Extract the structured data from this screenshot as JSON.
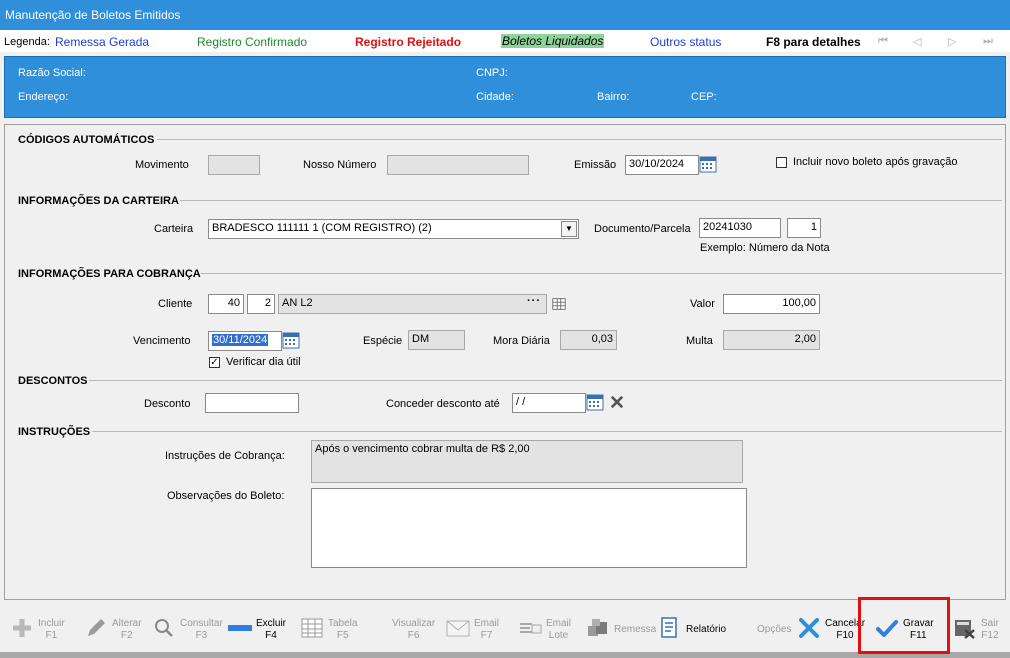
{
  "window": {
    "title": "Manutenção de Boletos Emitidos"
  },
  "legend": {
    "label": "Legenda:",
    "items": [
      {
        "text": "Remessa Gerada",
        "color": "#1a3fd6"
      },
      {
        "text": "Registro Confirmado",
        "color": "#1a8a2a"
      },
      {
        "text": "Registro Rejeitado",
        "color": "#e01010"
      },
      {
        "text": "Boletos Liquidados",
        "color": "#000000",
        "bg": "#8ed39a"
      },
      {
        "text": "Outros status",
        "color": "#1a3fd6"
      }
    ],
    "hint": "F8 para detalhes",
    "nav_icons": [
      "first-icon",
      "prev-icon",
      "next-icon",
      "last-icon"
    ]
  },
  "info": {
    "razao_social": "Razão Social:",
    "cnpj": "CNPJ:",
    "endereco": "Endereço:",
    "cidade": "Cidade:",
    "bairro": "Bairro:",
    "cep": "CEP:"
  },
  "codigos": {
    "section": "CÓDIGOS AUTOMÁTICOS",
    "movimento_label": "Movimento",
    "movimento_value": "",
    "nosso_numero_label": "Nosso Número",
    "nosso_numero_value": "",
    "emissao_label": "Emissão",
    "emissao_value": "30/10/2024",
    "incluir_novo_label": "Incluir novo boleto após gravação",
    "incluir_novo_checked": false
  },
  "carteira": {
    "section": "INFORMAÇÕES DA CARTEIRA",
    "carteira_label": "Carteira",
    "carteira_value": "BRADESCO  111111 1 (COM REGISTRO)  (2)",
    "documento_label": "Documento/Parcela",
    "documento_value": "20241030",
    "parcela_value": "1",
    "exemplo": "Exemplo: Número da Nota"
  },
  "cobranca": {
    "section": "INFORMAÇÕES PARA COBRANÇA",
    "cliente_label": "Cliente",
    "cliente_codigo": "40",
    "cliente_sub": "2",
    "cliente_nome": "AN L2",
    "cliente_more": "···",
    "valor_label": "Valor",
    "valor_value": "100,00",
    "vencimento_label": "Vencimento",
    "vencimento_value": "30/11/2024",
    "especie_label": "Espécie",
    "especie_value": "DM",
    "mora_label": "Mora Diária",
    "mora_value": "0,03",
    "multa_label": "Multa",
    "multa_value": "2,00",
    "verificar_label": "Verificar dia útil",
    "verificar_checked": true
  },
  "descontos": {
    "section": "DESCONTOS",
    "desconto_label": "Desconto",
    "desconto_value": "",
    "conceder_label": "Conceder desconto até",
    "conceder_value": " / /"
  },
  "instrucoes": {
    "section": "INSTRUÇÕES",
    "instrucoes_label": "Instruções de Cobrança:",
    "instrucoes_value": "Após o vencimento cobrar multa de R$ 2,00",
    "observacoes_label": "Observações do Boleto:",
    "observacoes_value": ""
  },
  "toolbar": {
    "incluir": {
      "label": "Incluir",
      "key": "F1"
    },
    "alterar": {
      "label": "Alterar",
      "key": "F2"
    },
    "consultar": {
      "label": "Consultar",
      "key": "F3"
    },
    "excluir": {
      "label": "Excluir",
      "key": "F4"
    },
    "tabela": {
      "label": "Tabela",
      "key": "F5"
    },
    "visualizar": {
      "label": "Visualizar",
      "key": "F6"
    },
    "email": {
      "label": "Email",
      "key": "F7"
    },
    "email_lote": {
      "label": "Email",
      "key": "Lote"
    },
    "remessa": {
      "label": "Remessa"
    },
    "relatorio": {
      "label": "Relatório"
    },
    "opcoes": {
      "label": "Opções"
    },
    "cancelar": {
      "label": "Cancelar",
      "key": "F10"
    },
    "gravar": {
      "label": "Gravar",
      "key": "F11"
    },
    "sair": {
      "label": "Sair",
      "key": "F12"
    }
  }
}
